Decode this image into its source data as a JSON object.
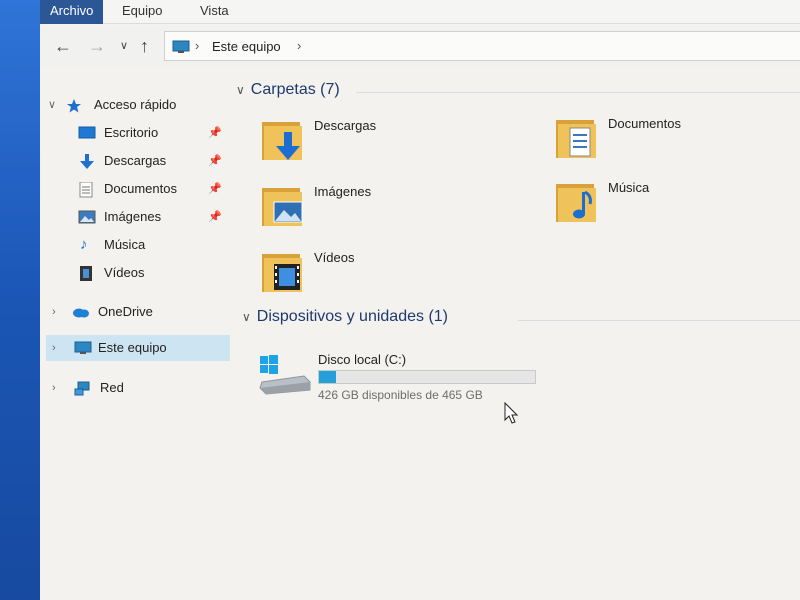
{
  "ribbon": {
    "tabs": [
      {
        "label": "Archivo",
        "active": true
      },
      {
        "label": "Equipo",
        "active": false
      },
      {
        "label": "Vista",
        "active": false
      }
    ]
  },
  "nav": {
    "back_icon": "back-arrow-icon",
    "forward_icon": "forward-arrow-icon",
    "recent_icon": "chevron-down-icon",
    "up_icon": "up-arrow-icon"
  },
  "address": {
    "icon": "computer-icon",
    "crumb": "Este equipo"
  },
  "sidebar": {
    "quick_access": {
      "label": "Acceso rápido",
      "items": [
        {
          "label": "Escritorio",
          "pinned": true
        },
        {
          "label": "Descargas",
          "pinned": true
        },
        {
          "label": "Documentos",
          "pinned": true
        },
        {
          "label": "Imágenes",
          "pinned": true
        },
        {
          "label": "Música",
          "pinned": false
        },
        {
          "label": "Vídeos",
          "pinned": false
        }
      ]
    },
    "onedrive": {
      "label": "OneDrive"
    },
    "this_pc": {
      "label": "Este equipo",
      "selected": true
    },
    "network": {
      "label": "Red"
    }
  },
  "main": {
    "folders_header": "Carpetas (7)",
    "folders": [
      {
        "label": "Descargas",
        "icon": "downloads-folder-icon"
      },
      {
        "label": "Documentos",
        "icon": "documents-folder-icon"
      },
      {
        "label": "Imágenes",
        "icon": "pictures-folder-icon"
      },
      {
        "label": "Música",
        "icon": "music-folder-icon"
      },
      {
        "label": "Vídeos",
        "icon": "videos-folder-icon"
      }
    ],
    "devices_header": "Dispositivos y unidades (1)",
    "drives": [
      {
        "name": "Disco local (C:)",
        "free_text": "426 GB disponibles de 465 GB",
        "used_fraction": 0.08
      }
    ]
  },
  "colors": {
    "accent": "#2b5797",
    "selection": "#cde5f3",
    "drive_fill": "#26a0da",
    "folder": "#e8b34a"
  }
}
